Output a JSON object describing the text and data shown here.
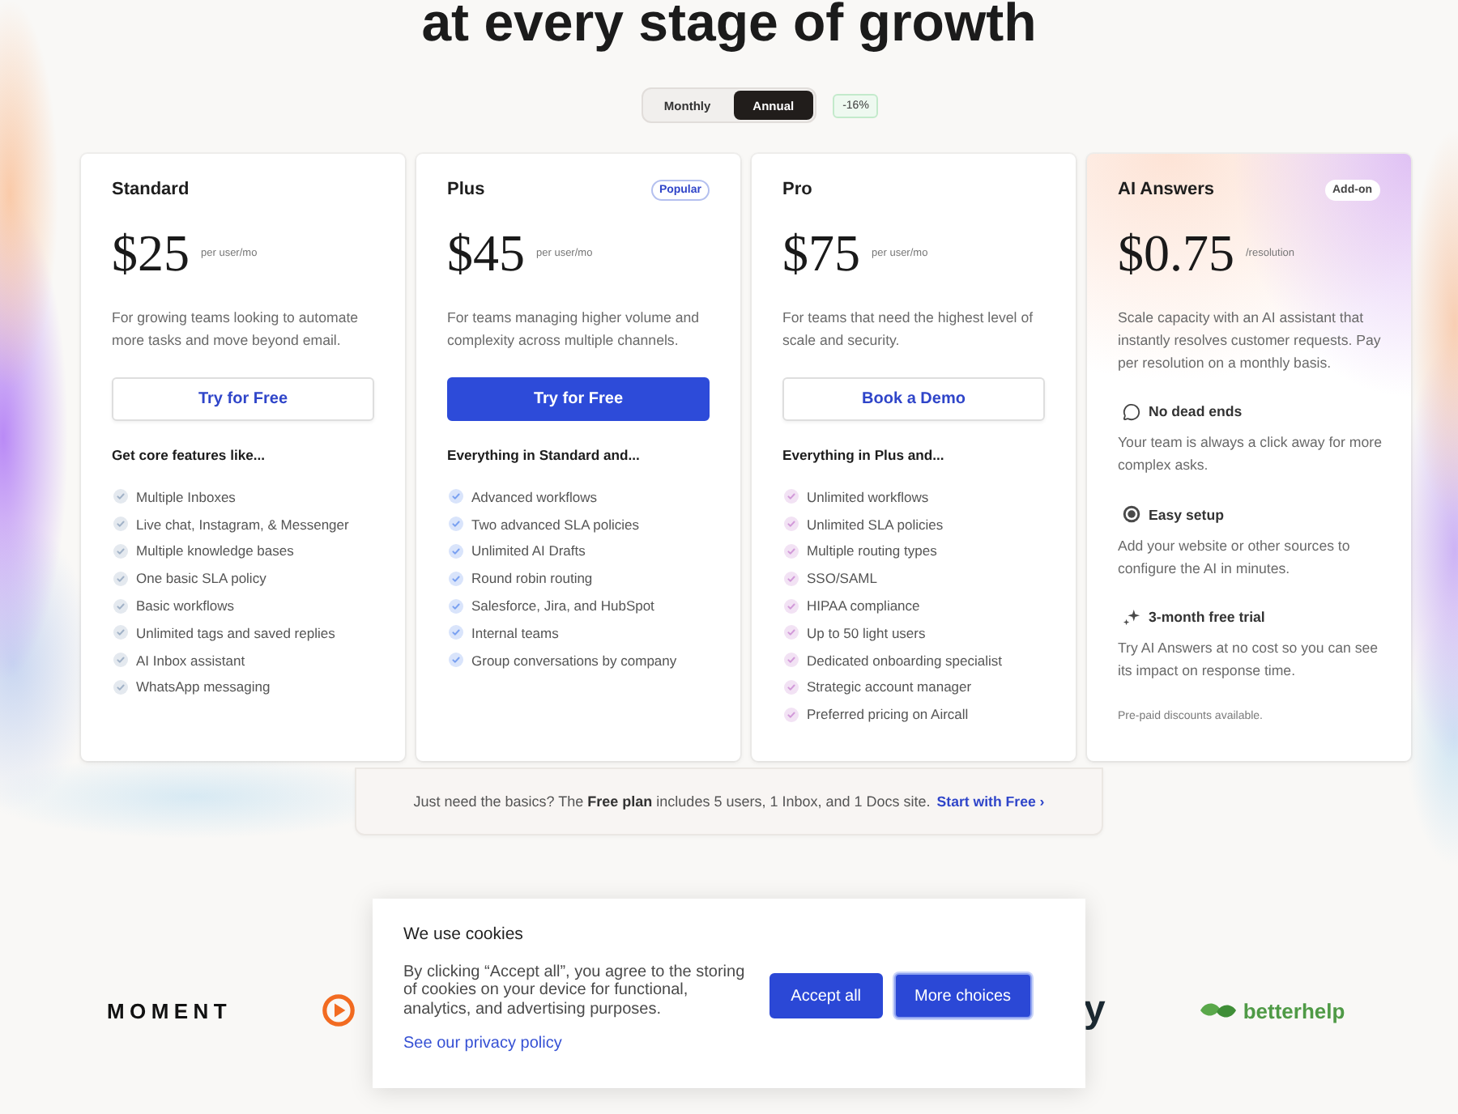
{
  "heading": "at every stage of growth",
  "billing_toggle": {
    "options": [
      {
        "label": "Monthly",
        "selected": false
      },
      {
        "label": "Annual",
        "selected": true
      }
    ],
    "discount_badge": "-16%"
  },
  "plans": [
    {
      "kind": "tier",
      "name": "Standard",
      "price": "$25",
      "unit": "per user/mo",
      "description": "For growing teams looking to automate more tasks and move beyond email.",
      "button": {
        "label": "Try for Free",
        "primary": false
      },
      "features_heading": "Get core features like...",
      "color": "#e4e9ef",
      "features": [
        "Multiple Inboxes",
        "Live chat, Instagram, & Messenger",
        "Multiple knowledge bases",
        "One basic SLA policy",
        "Basic workflows",
        "Unlimited tags and saved replies",
        "AI Inbox assistant",
        "WhatsApp messaging"
      ]
    },
    {
      "kind": "tier",
      "name": "Plus",
      "badge": "Popular",
      "price": "$45",
      "unit": "per user/mo",
      "description": "For teams managing higher volume and complexity across multiple channels.",
      "button": {
        "label": "Try for Free",
        "primary": true
      },
      "features_heading": "Everything in Standard and...",
      "color": "#d9e4fb",
      "features": [
        "Advanced workflows",
        "Two advanced SLA policies",
        "Unlimited AI Drafts",
        "Round robin routing",
        "Salesforce, Jira, and HubSpot",
        "Internal teams",
        "Group conversations by company"
      ]
    },
    {
      "kind": "tier",
      "name": "Pro",
      "price": "$75",
      "unit": "per user/mo",
      "description": "For teams that need the highest level of scale and security.",
      "button": {
        "label": "Book a Demo",
        "primary": false
      },
      "features_heading": "Everything in Plus and...",
      "color": "#f2e2f4",
      "features": [
        "Unlimited workflows",
        "Unlimited SLA policies",
        "Multiple routing types",
        "SSO/SAML",
        "HIPAA compliance",
        "Up to 50 light users",
        "Dedicated onboarding specialist",
        "Strategic account manager",
        "Preferred pricing on Aircall"
      ]
    },
    {
      "kind": "addon",
      "name": "AI Answers",
      "badge": "Add-on",
      "price": "$0.75",
      "unit": "/resolution",
      "description": "Scale capacity with an AI assistant that instantly resolves customer requests. Pay per resolution on a monthly basis.",
      "highlights": [
        {
          "title": "No dead ends",
          "text": "Your team is always a click away for more complex asks."
        },
        {
          "title": "Easy setup",
          "text": "Add your website or other sources to configure the AI in minutes."
        },
        {
          "title": "3-month free trial",
          "text": "Try AI Answers at no cost so you can see its impact on response time."
        }
      ],
      "footnote": "Pre-paid discounts available."
    }
  ],
  "free_banner": {
    "text": "Just need the basics? The **Free plan** includes 5 users, 1 Inbox, and 1 Docs site.",
    "link": "Start with Free ›"
  },
  "logos": [
    {
      "kind": "wordmark",
      "text": "MOMENT"
    },
    {
      "kind": "mark"
    },
    {
      "kind": "wordmark_large",
      "text": "y"
    },
    {
      "kind": "mark_wordmark",
      "text": "betterhelp"
    }
  ],
  "cookie_dialog": {
    "title": "We use cookies",
    "text": "By clicking “Accept all”, you agree to the storing of cookies on your device for functional, analytics, and advertising purposes.",
    "link": "See our privacy policy",
    "buttons": [
      {
        "label": "Accept all",
        "focused": false
      },
      {
        "label": "More choices",
        "focused": true
      }
    ]
  }
}
